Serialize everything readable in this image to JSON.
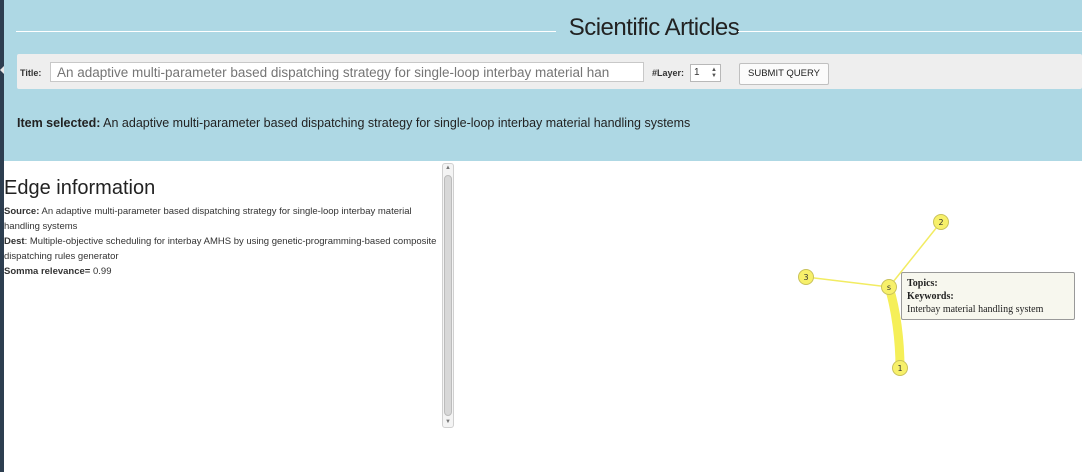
{
  "header": {
    "title": "Scientific Articles",
    "title_label": "Title:",
    "title_placeholder": "An adaptive multi-parameter based dispatching strategy for single-loop interbay material han",
    "layer_label": "#Layer:",
    "layer_value": "1",
    "submit_label": "SUBMIT QUERY",
    "item_selected_label": "Item selected:",
    "item_selected_value": "An adaptive multi-parameter based dispatching strategy for single-loop interbay material handling systems"
  },
  "edge_info": {
    "heading": "Edge information",
    "source_label": "Source:",
    "source_value": "An adaptive multi-parameter based dispatching strategy for single-loop interbay material handling systems",
    "dest_label": "Dest",
    "dest_value": ": Multiple-objective scheduling for interbay AMHS by using genetic-programming-based composite dispatching rules generator",
    "relevance_label": "Somma relevance=",
    "relevance_value": "0.99"
  },
  "graph": {
    "nodes": [
      {
        "id": "2"
      },
      {
        "id": "3"
      },
      {
        "id": "s"
      },
      {
        "id": "1"
      }
    ],
    "node_color": "#f7f06a",
    "edge_color": "#f2ec62"
  },
  "tooltip": {
    "topics_label": "Topics:",
    "keywords_label": "Keywords:",
    "keywords_value": "Interbay material handling system"
  }
}
